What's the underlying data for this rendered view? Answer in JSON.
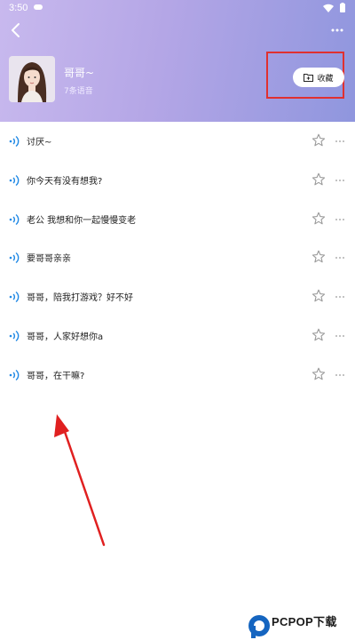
{
  "status_bar": {
    "time": "3:50"
  },
  "header": {
    "name": "哥哥~",
    "voice_count": "7条语音",
    "favorite_label": "收藏"
  },
  "colors": {
    "header_gradient_start": "#c8b9ee",
    "header_gradient_end": "#8f96de",
    "sound_icon": "#1e88e5",
    "highlight_box": "#e03030",
    "annotation_arrow": "#e02020"
  },
  "icons": {
    "back": "chevron-left-icon",
    "more": "more-dots-icon",
    "favorite": "folder-plus-icon",
    "sound": "sound-wave-icon",
    "star": "star-outline-icon"
  },
  "voice_list": [
    {
      "text": "讨厌~"
    },
    {
      "text": "你今天有没有想我?"
    },
    {
      "text": "老公 我想和你一起慢慢变老"
    },
    {
      "text": "要哥哥亲亲"
    },
    {
      "text": "哥哥，陪我打游戏？好不好"
    },
    {
      "text": "哥哥，人家好想你a"
    },
    {
      "text": "哥哥，在干嘛?"
    }
  ],
  "watermark": {
    "text": "PCPOP下载"
  }
}
